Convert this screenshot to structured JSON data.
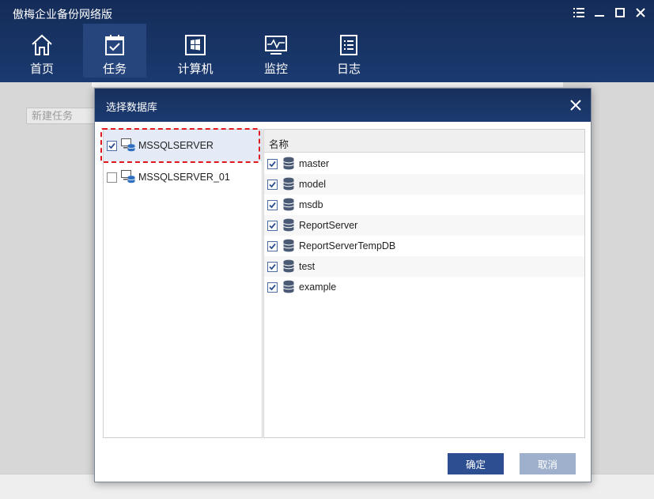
{
  "app": {
    "title": "傲梅企业备份网络版"
  },
  "window_controls": [
    {
      "name": "menu-icon"
    },
    {
      "name": "minimize-icon"
    },
    {
      "name": "maximize-icon"
    },
    {
      "name": "close-icon"
    }
  ],
  "nav": {
    "items": [
      {
        "label": "首页",
        "icon": "home-icon",
        "active": false
      },
      {
        "label": "任务",
        "icon": "task-calendar-icon",
        "active": true
      },
      {
        "label": "计算机",
        "icon": "computer-windows-icon",
        "active": false
      },
      {
        "label": "监控",
        "icon": "monitor-icon",
        "active": false
      },
      {
        "label": "日志",
        "icon": "log-icon",
        "active": false
      }
    ]
  },
  "background": {
    "new_task_label": "新建任务"
  },
  "dialog": {
    "title": "选择数据库",
    "servers": [
      {
        "label": "MSSQLSERVER",
        "checked": true,
        "selected": true
      },
      {
        "label": "MSSQLSERVER_01",
        "checked": false,
        "selected": false
      }
    ],
    "column_header": "名称",
    "databases": [
      {
        "label": "master",
        "checked": true
      },
      {
        "label": "model",
        "checked": true
      },
      {
        "label": "msdb",
        "checked": true
      },
      {
        "label": "ReportServer",
        "checked": true
      },
      {
        "label": "ReportServerTempDB",
        "checked": true
      },
      {
        "label": "test",
        "checked": true
      },
      {
        "label": "example",
        "checked": true
      }
    ],
    "ok_label": "确定",
    "cancel_label": "取消"
  },
  "colors": {
    "header_bg": "#1b3a70",
    "accent": "#2d4f92",
    "highlight_dashed": "#e0191f",
    "selected_row": "#e4ebf6"
  }
}
